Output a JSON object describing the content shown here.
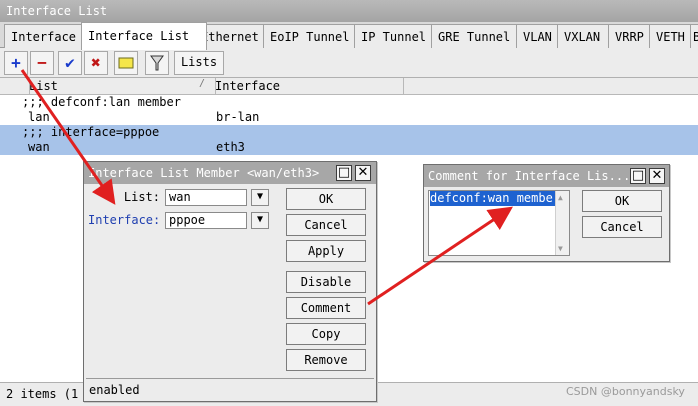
{
  "window": {
    "title": "Interface List"
  },
  "tabs": [
    {
      "label": "Interface"
    },
    {
      "label": "Interface List"
    },
    {
      "label": "Ethernet"
    },
    {
      "label": "EoIP Tunnel"
    },
    {
      "label": "IP Tunnel"
    },
    {
      "label": "GRE Tunnel"
    },
    {
      "label": "VLAN"
    },
    {
      "label": "VXLAN"
    },
    {
      "label": "VRRP"
    },
    {
      "label": "VETH"
    },
    {
      "label": "B"
    }
  ],
  "toolbar": {
    "add_icon": "plus-icon",
    "remove_icon": "minus-icon",
    "enable_icon": "check-icon",
    "disable_icon": "x-icon",
    "comment_icon": "note-icon",
    "filter_icon": "filter-icon",
    "lists_label": "Lists"
  },
  "table": {
    "headers": [
      "List",
      "Interface"
    ],
    "rows": [
      {
        "comment": ";;; defconf:lan member"
      },
      {
        "list": "lan",
        "interface": "br-lan"
      },
      {
        "comment": ";;; interface=pppoe"
      },
      {
        "list": "wan",
        "interface": "eth3"
      }
    ]
  },
  "status": {
    "items": "2 items (1"
  },
  "member_dialog": {
    "title": "Interface List Member <wan/eth3>",
    "list_label": "List:",
    "list_value": "wan",
    "interface_label": "Interface:",
    "interface_value": "pppoe",
    "buttons": [
      "OK",
      "Cancel",
      "Apply",
      "Disable",
      "Comment",
      "Copy",
      "Remove"
    ],
    "status": "enabled"
  },
  "comment_dialog": {
    "title": "Comment for Interface Lis...",
    "text": "defconf:wan member",
    "ok_label": "OK",
    "cancel_label": "Cancel"
  },
  "watermark": "CSDN @bonnyandsky",
  "colors": {
    "selected_row": "#a7c3e9",
    "annotation_arrow": "#e02020",
    "interface_label": "#1f3fb0"
  }
}
